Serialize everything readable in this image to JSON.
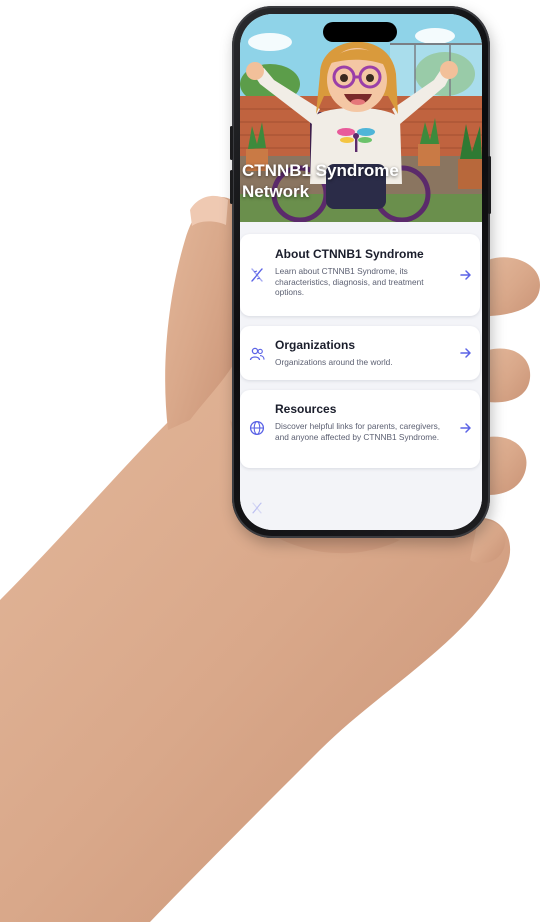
{
  "app": {
    "title": "CTNNB1 Syndrome Network"
  },
  "menu": [
    {
      "title": "About CTNNB1 Syndrome",
      "description": "Learn about CTNNB1 Syndrome, its characteristics, diagnosis, and treatment options.",
      "icon": "dna-icon"
    },
    {
      "title": "Organizations",
      "description": "Organizations around the world.",
      "icon": "people-icon"
    },
    {
      "title": "Resources",
      "description": "Discover helpful links for parents, caregivers, and anyone affected by CTNNB1 Syndrome.",
      "icon": "globe-icon"
    }
  ],
  "colors": {
    "accent": "#5b63e6",
    "card_bg": "#ffffff",
    "screen_bg": "#f3f4f8",
    "title_text": "#1a1d2b",
    "body_text": "#5c6072"
  }
}
